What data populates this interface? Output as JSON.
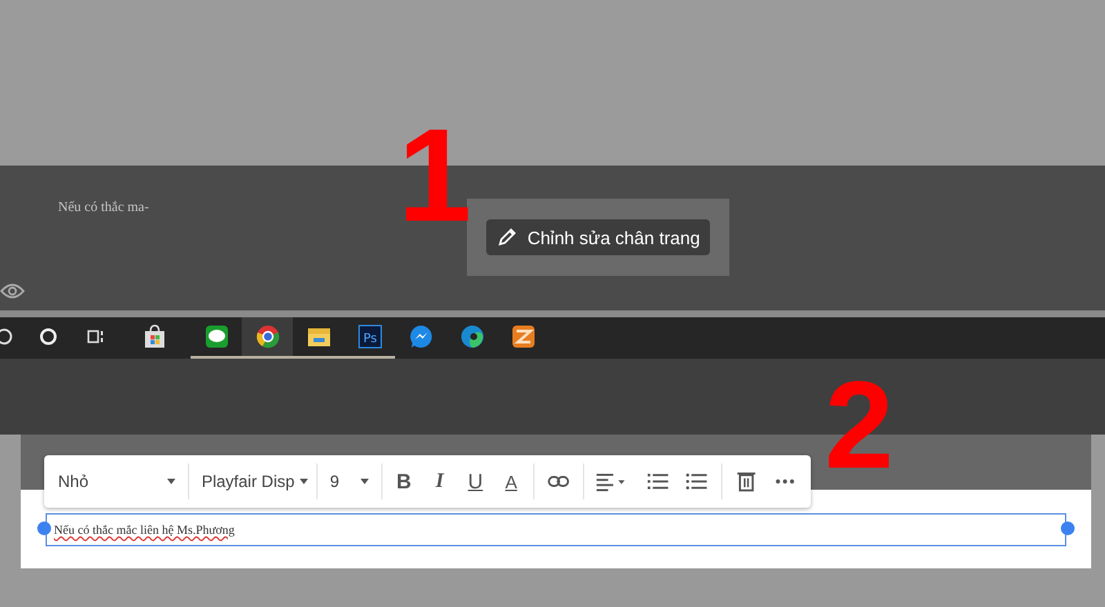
{
  "annotations": [
    "1",
    "2"
  ],
  "footer_preview": {
    "text": "Nếu có thắc ma-",
    "edit_button": "Chỉnh sửa chân trang"
  },
  "taskbar": [
    {
      "kind": "search",
      "running": false,
      "selected": false
    },
    {
      "kind": "cortana",
      "running": false,
      "selected": false
    },
    {
      "kind": "taskview",
      "running": false,
      "selected": false
    },
    {
      "kind": "store",
      "running": false,
      "selected": false
    },
    {
      "kind": "line",
      "running": true,
      "selected": false
    },
    {
      "kind": "chrome",
      "running": true,
      "selected": true
    },
    {
      "kind": "files",
      "running": true,
      "selected": false
    },
    {
      "kind": "photoshop",
      "label": "Ps",
      "running": true,
      "selected": false
    },
    {
      "kind": "messenger",
      "running": false,
      "selected": false
    },
    {
      "kind": "edge",
      "running": false,
      "selected": false
    },
    {
      "kind": "app",
      "running": false,
      "selected": false
    }
  ],
  "toolbar": {
    "style": "Nhỏ",
    "font": "Playfair Disp",
    "size": "9",
    "bold": "B",
    "italic": "I",
    "underline": "U",
    "text_color": "A"
  },
  "footer_field": {
    "value": "Nếu có thắc mắc liên hệ Ms.Phương"
  }
}
